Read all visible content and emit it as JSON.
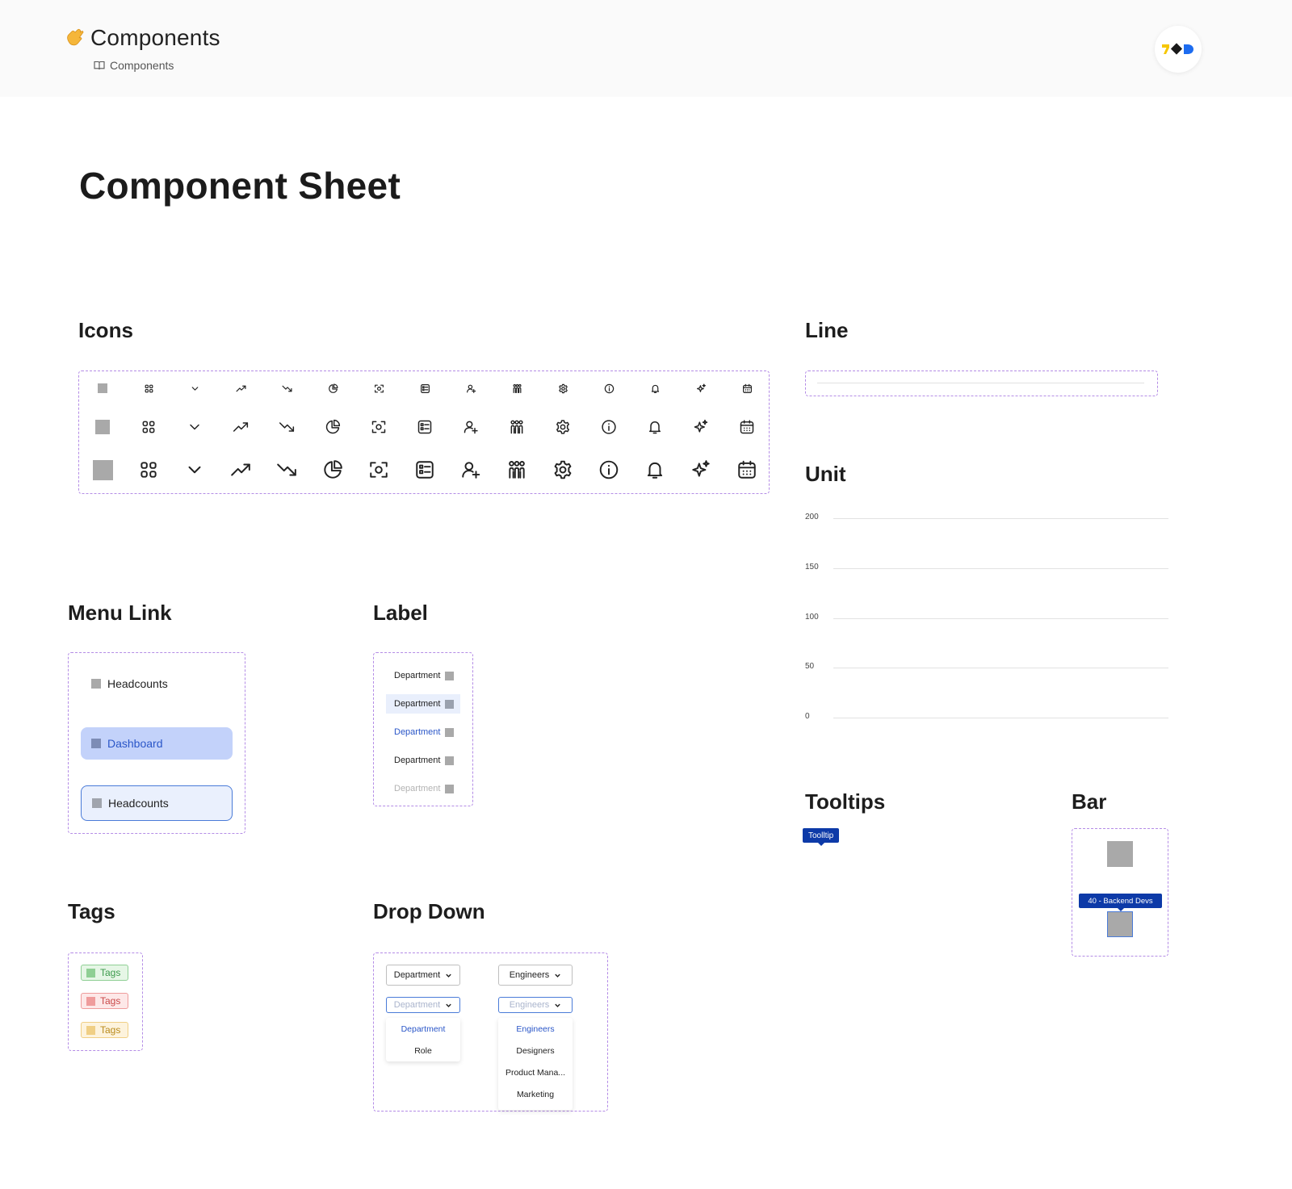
{
  "header": {
    "title": "Components",
    "breadcrumb": "Components"
  },
  "page_title": "Component Sheet",
  "sections": {
    "icons": "Icons",
    "line": "Line",
    "unit": "Unit",
    "menu_link": "Menu Link",
    "label": "Label",
    "tooltips": "Tooltips",
    "bar": "Bar",
    "tags": "Tags",
    "drop_down": "Drop Down"
  },
  "icons": [
    "square",
    "grid",
    "chevron-down",
    "trend-up",
    "trend-down",
    "pie-chart",
    "focus",
    "list-card",
    "user-add",
    "team",
    "gear",
    "info",
    "bell",
    "sparkle",
    "calendar"
  ],
  "unit_chart": {
    "ticks": [
      "200",
      "150",
      "100",
      "50",
      "0"
    ]
  },
  "menu_links": [
    {
      "label": "Headcounts",
      "state": "default"
    },
    {
      "label": "Dashboard",
      "state": "active"
    },
    {
      "label": "Headcounts",
      "state": "outlined"
    }
  ],
  "labels": [
    {
      "text": "Department",
      "state": "default"
    },
    {
      "text": "Department",
      "state": "hover"
    },
    {
      "text": "Department",
      "state": "selected"
    },
    {
      "text": "Department",
      "state": "default"
    },
    {
      "text": "Department",
      "state": "disabled"
    }
  ],
  "tooltips": {
    "basic": "Toolltip",
    "bar": "40 - Backend Devs"
  },
  "tags": [
    {
      "text": "Tags",
      "color": "#3a9a4a",
      "bg": "#e6f6e6",
      "border": "#8fcf94"
    },
    {
      "text": "Tags",
      "color": "#c94848",
      "bg": "#fde8e8",
      "border": "#ef9c9c"
    },
    {
      "text": "Tags",
      "color": "#b98a1b",
      "bg": "#fdf3dd",
      "border": "#f0cf85"
    }
  ],
  "dropdowns": {
    "department": {
      "value": "Department",
      "open_value": "Department",
      "options": [
        "Department",
        "Role"
      ]
    },
    "engineers": {
      "value": "Engineers",
      "open_value": "Engineers",
      "options": [
        "Engineers",
        "Designers",
        "Product Mana...",
        "Marketing"
      ]
    }
  },
  "colors": {
    "dashed_border": "#b48ce6",
    "accent_blue": "#2a56c8",
    "tooltip_bg": "#0d3aa8",
    "placeholder_gray": "#a9a9a9"
  }
}
